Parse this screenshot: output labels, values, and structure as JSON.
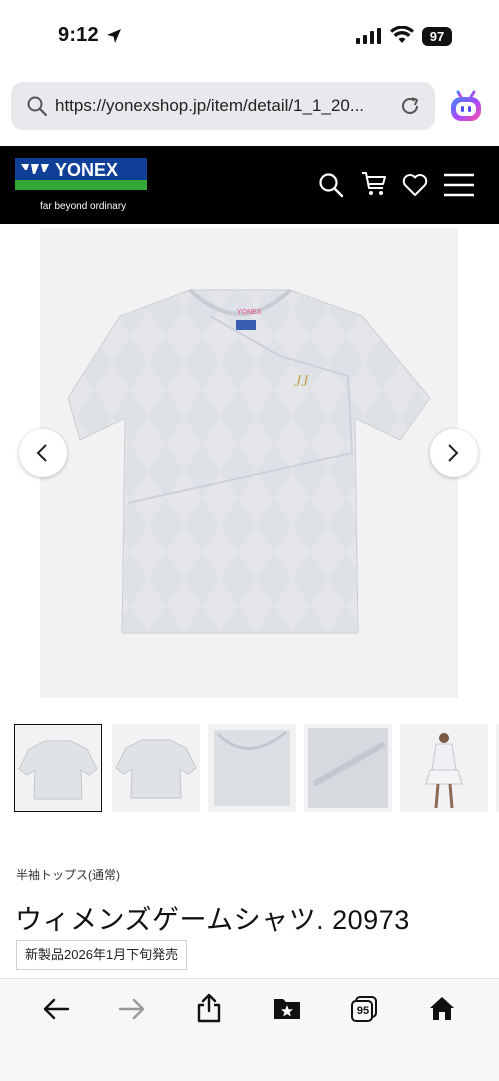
{
  "status_bar": {
    "time": "9:12",
    "battery": "97"
  },
  "browser": {
    "url": "https://yonexshop.jp/item/detail/1_1_20..."
  },
  "site": {
    "brand": "YONEX",
    "tagline": "far beyond ordinary"
  },
  "product": {
    "category": "半袖トップス(通常)",
    "title": "ウィメンズゲームシャツ. 20973",
    "badge": "新製品2026年1月下旬発売",
    "thumbnail_count": 6,
    "selected_thumbnail": 1
  },
  "toolbar": {
    "tabs_count": "95"
  },
  "colors": {
    "header_bg": "#000000",
    "logo_blue": "#0f3f96",
    "logo_green": "#31a736",
    "image_bg": "#f2f2f2"
  }
}
